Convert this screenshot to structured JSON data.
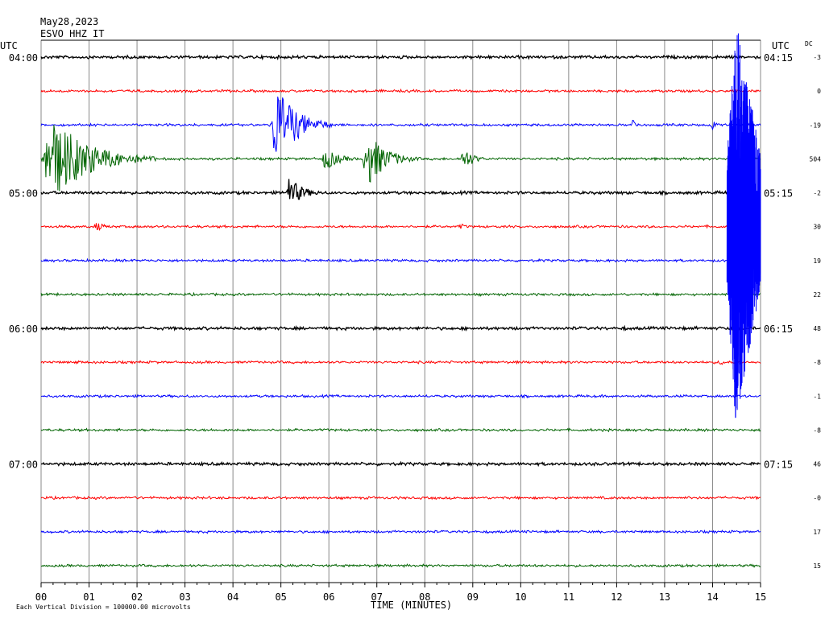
{
  "header": {
    "date": "May28,2023",
    "station": "ESVO HHZ IT",
    "left_tz": "UTC",
    "right_tz": "UTC",
    "dc_label": "DC"
  },
  "footer": {
    "xlabel": "TIME (MINUTES)",
    "scale_note": "Each Vertical Division = 100000.00 microvolts"
  },
  "chart_data": {
    "type": "line",
    "title": "",
    "xlabel": "TIME (MINUTES)",
    "x_ticks": [
      "00",
      "01",
      "02",
      "03",
      "04",
      "05",
      "06",
      "07",
      "08",
      "09",
      "10",
      "11",
      "12",
      "13",
      "14",
      "15"
    ],
    "xlim": [
      0,
      15
    ],
    "grid": true,
    "line_colors": [
      "#000000",
      "#ff0000",
      "#0000ff",
      "#006400"
    ],
    "traces": [
      {
        "left_label": "04:00",
        "right_label": "04:15",
        "dc": "-3",
        "color": "#000000"
      },
      {
        "left_label": "",
        "right_label": "",
        "dc": "0",
        "color": "#ff0000"
      },
      {
        "left_label": "",
        "right_label": "",
        "dc": "-19",
        "color": "#0000ff"
      },
      {
        "left_label": "",
        "right_label": "",
        "dc": "504",
        "color": "#006400"
      },
      {
        "left_label": "05:00",
        "right_label": "05:15",
        "dc": "-2",
        "color": "#000000"
      },
      {
        "left_label": "",
        "right_label": "",
        "dc": "30",
        "color": "#ff0000"
      },
      {
        "left_label": "",
        "right_label": "",
        "dc": "19",
        "color": "#0000ff"
      },
      {
        "left_label": "",
        "right_label": "",
        "dc": "22",
        "color": "#006400"
      },
      {
        "left_label": "06:00",
        "right_label": "06:15",
        "dc": "48",
        "color": "#000000"
      },
      {
        "left_label": "",
        "right_label": "",
        "dc": "-8",
        "color": "#ff0000"
      },
      {
        "left_label": "",
        "right_label": "",
        "dc": "-1",
        "color": "#0000ff"
      },
      {
        "left_label": "",
        "right_label": "",
        "dc": "-8",
        "color": "#006400"
      },
      {
        "left_label": "07:00",
        "right_label": "07:15",
        "dc": "46",
        "color": "#000000"
      },
      {
        "left_label": "",
        "right_label": "",
        "dc": "-0",
        "color": "#ff0000"
      },
      {
        "left_label": "",
        "right_label": "",
        "dc": "17",
        "color": "#0000ff"
      },
      {
        "left_label": "",
        "right_label": "",
        "dc": "15",
        "color": "#006400"
      }
    ],
    "events": [
      {
        "trace": 0,
        "minute": 14.3,
        "duration": 0.7,
        "amplitude": 0.5,
        "color": "#0000ff",
        "kind": "large"
      },
      {
        "trace": 2,
        "minute": 4.78,
        "duration": 1.3,
        "amplitude": 1.3
      },
      {
        "trace": 2,
        "minute": 12.3,
        "duration": 0.35,
        "amplitude": 0.18
      },
      {
        "trace": 2,
        "minute": 13.95,
        "duration": 0.3,
        "amplitude": 0.2
      },
      {
        "trace": 3,
        "minute": 0.0,
        "duration": 2.4,
        "amplitude": 1.3
      },
      {
        "trace": 3,
        "minute": 5.85,
        "duration": 0.9,
        "amplitude": 0.35
      },
      {
        "trace": 3,
        "minute": 6.7,
        "duration": 1.2,
        "amplitude": 0.85
      },
      {
        "trace": 3,
        "minute": 8.75,
        "duration": 0.6,
        "amplitude": 0.4
      },
      {
        "trace": 4,
        "minute": 5.1,
        "duration": 0.9,
        "amplitude": 0.45
      },
      {
        "trace": 5,
        "minute": 1.1,
        "duration": 0.6,
        "amplitude": 0.15
      },
      {
        "trace": 5,
        "minute": 8.7,
        "duration": 0.35,
        "amplitude": 0.12
      },
      {
        "trace": 8,
        "minute": 12.1,
        "duration": 0.4,
        "amplitude": 0.08
      },
      {
        "trace": 9,
        "minute": 0.7,
        "duration": 0.4,
        "amplitude": 0.08
      },
      {
        "trace": 9,
        "minute": 14.1,
        "duration": 0.5,
        "amplitude": 0.1
      }
    ]
  }
}
